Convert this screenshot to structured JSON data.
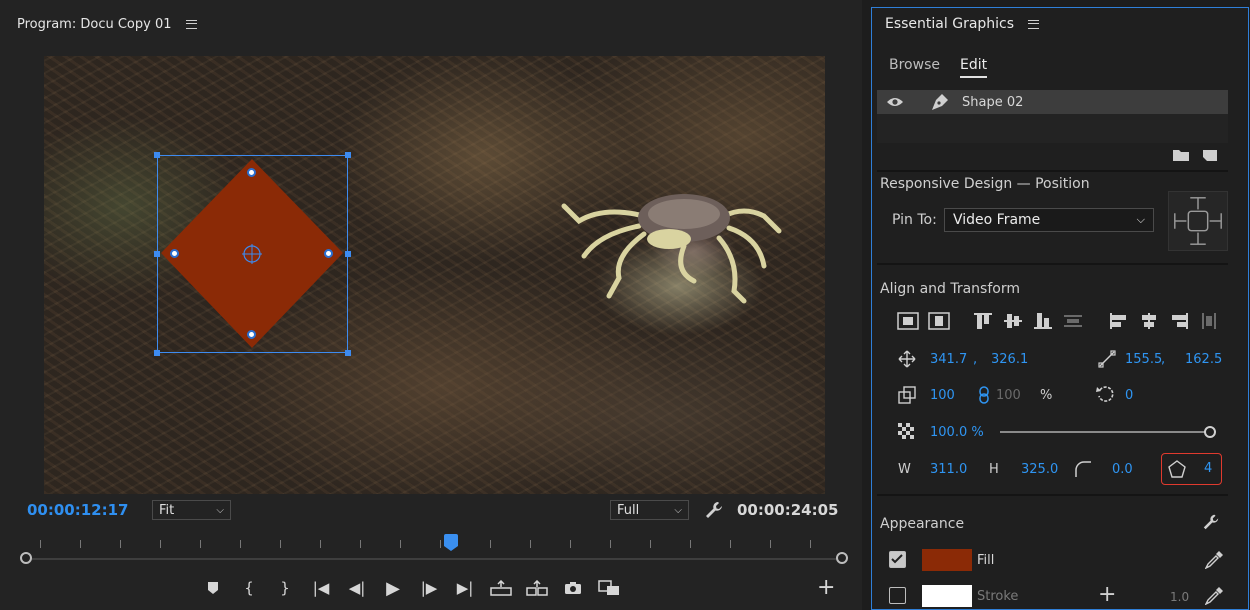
{
  "monitor": {
    "title": "Program: Docu Copy 01",
    "timecode_current": "00:00:12:17",
    "timecode_duration": "00:00:24:05",
    "zoom_select": "Fit",
    "quality_select": "Full",
    "shape_fill_color": "#8b2a06"
  },
  "essential_graphics": {
    "title": "Essential Graphics",
    "tabs": {
      "browse": "Browse",
      "edit": "Edit"
    },
    "layer": {
      "name": "Shape 02"
    },
    "responsive": {
      "title": "Responsive Design — Position",
      "pin_label": "Pin To:",
      "pin_value": "Video Frame"
    },
    "align": {
      "title": "Align and Transform",
      "position_x": "341.7",
      "position_y": "326.1",
      "anchor_x": "155.5",
      "anchor_y": "162.5",
      "scale": "100",
      "scale_linked": "100",
      "scale_unit": "%",
      "rotation": "0",
      "opacity": "100.0 %",
      "opacity_fraction": 1.0,
      "width_label": "W",
      "width": "311.0",
      "height_label": "H",
      "height": "325.0",
      "corner_radius": "0.0",
      "vertices": "4"
    },
    "appearance": {
      "title": "Appearance",
      "fill_label": "Fill",
      "fill_color": "#8b2a06",
      "fill_checked": true,
      "stroke_label": "Stroke",
      "stroke_color": "#ffffff",
      "stroke_checked": false,
      "stroke_width": "1.0"
    },
    "accent_color": "#2f95f2",
    "highlight_color": "#e03a2e"
  }
}
